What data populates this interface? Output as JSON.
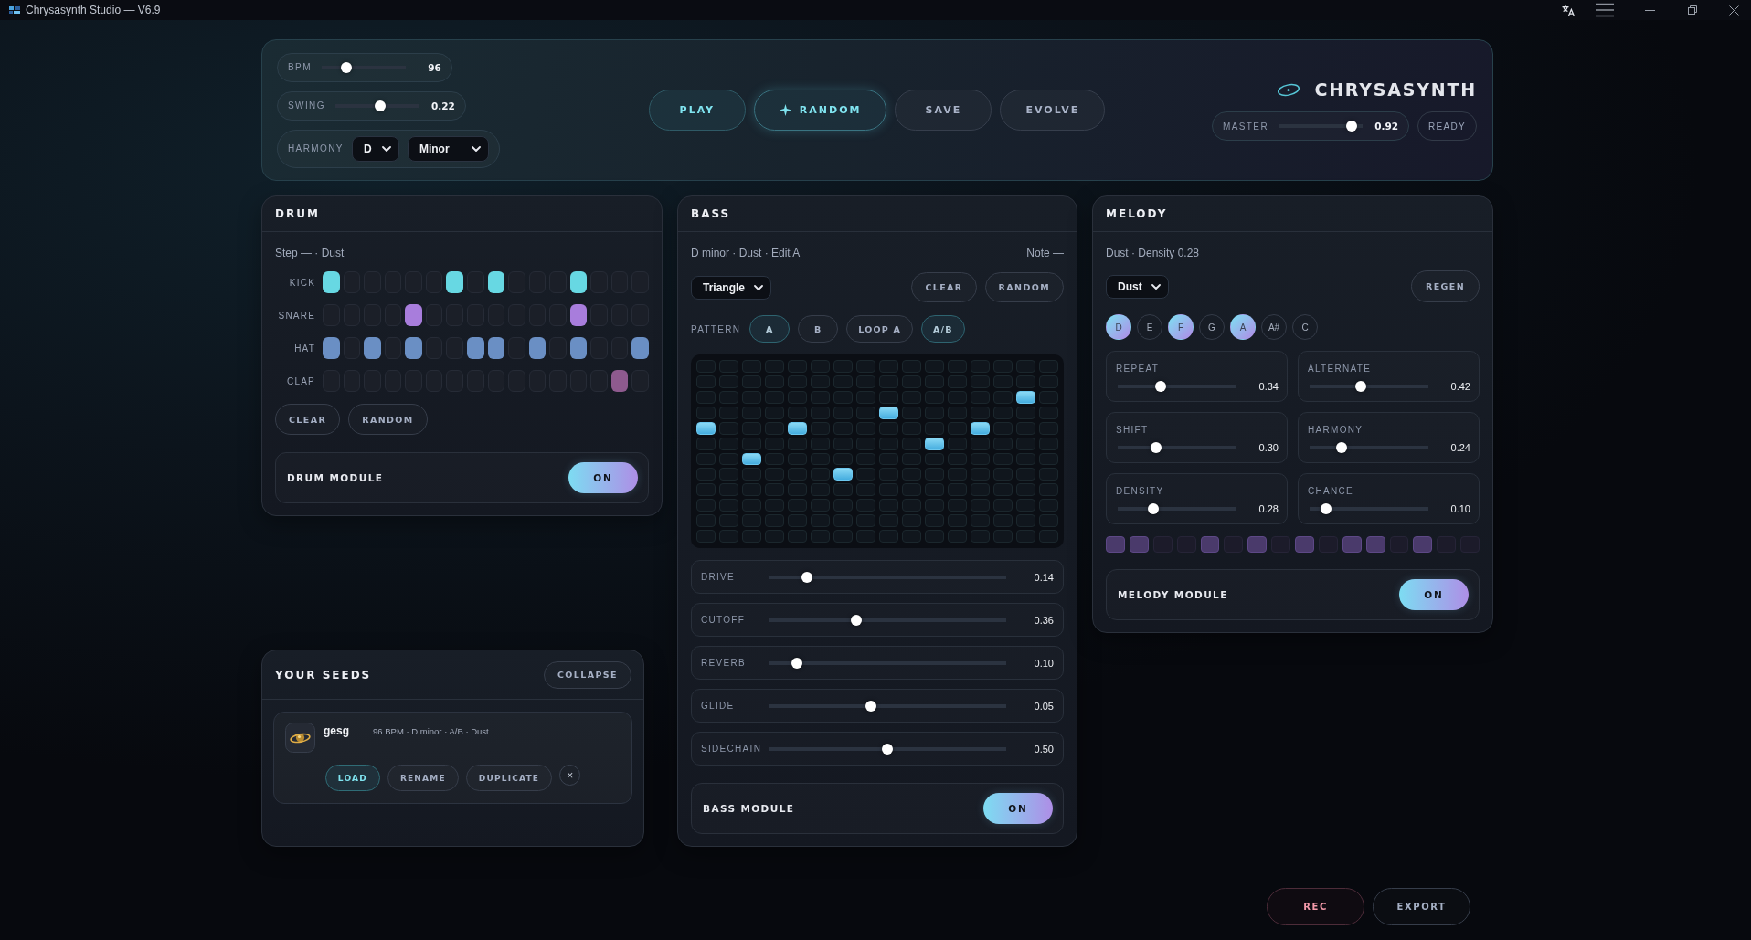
{
  "window": {
    "title": "Chrysasynth Studio — V6.9"
  },
  "header": {
    "params": [
      {
        "kind": "slider",
        "label": "BPM",
        "level": 0.3,
        "reading": "96"
      },
      {
        "kind": "slider",
        "label": "SWING",
        "level": 0.53,
        "reading": "0.22"
      },
      {
        "kind": "selects",
        "label": "HARMONY",
        "selects": [
          {
            "value": "D"
          },
          {
            "value": "Minor"
          }
        ]
      }
    ],
    "actions": [
      {
        "kind": "accent",
        "label": "PLAY"
      },
      {
        "kind": "featured",
        "label": "RANDOM"
      },
      {
        "kind": "plain",
        "label": "SAVE"
      },
      {
        "kind": "plain",
        "label": "EVOLVE"
      }
    ],
    "brand": {
      "name": "CHRYSASYNTH"
    },
    "master": {
      "label": "MASTER",
      "level": 0.87,
      "reading": "0.92"
    },
    "status": "READY"
  },
  "drum": {
    "title": "DRUM",
    "subtitle": "Step — · Dust",
    "rows": [
      {
        "label": "KICK",
        "color": "#67d8e3",
        "steps": [
          true,
          false,
          false,
          false,
          false,
          false,
          true,
          false,
          true,
          false,
          false,
          false,
          true,
          false,
          false,
          false
        ]
      },
      {
        "label": "SNARE",
        "color": "#a87ddc",
        "steps": [
          false,
          false,
          false,
          false,
          true,
          false,
          false,
          false,
          false,
          false,
          false,
          false,
          true,
          false,
          false,
          false
        ]
      },
      {
        "label": "HAT",
        "color": "#6a8fc4",
        "steps": [
          true,
          false,
          true,
          false,
          true,
          false,
          false,
          true,
          true,
          false,
          true,
          false,
          true,
          false,
          false,
          true
        ]
      },
      {
        "label": "CLAP",
        "color": "#8e5a8e",
        "steps": [
          false,
          false,
          false,
          false,
          false,
          false,
          false,
          false,
          false,
          false,
          false,
          false,
          false,
          false,
          true,
          false
        ]
      }
    ],
    "buttons": [
      "CLEAR",
      "RANDOM"
    ],
    "module": {
      "label": "DRUM MODULE",
      "toggle": {
        "label": "ON",
        "on": true
      }
    }
  },
  "bass": {
    "title": "BASS",
    "subtitle": "D minor · Dust · Edit A",
    "note": "Note —",
    "wave": {
      "value": "Triangle"
    },
    "buttons": [
      "CLEAR",
      "RANDOM"
    ],
    "pattern": {
      "label": "PATTERN",
      "options": [
        {
          "label": "A",
          "selected": true
        },
        {
          "label": "B",
          "selected": false
        },
        {
          "label": "LOOP A",
          "selected": false
        },
        {
          "label": "A/B",
          "selected": true
        }
      ]
    },
    "grid": [
      [
        false,
        false,
        false,
        false,
        false,
        false,
        false,
        false,
        false,
        false,
        false,
        false,
        false,
        false,
        false,
        false
      ],
      [
        false,
        false,
        false,
        false,
        false,
        false,
        false,
        false,
        false,
        false,
        false,
        false,
        false,
        false,
        false,
        false
      ],
      [
        false,
        false,
        false,
        false,
        false,
        false,
        false,
        false,
        false,
        false,
        false,
        false,
        false,
        false,
        true,
        false
      ],
      [
        false,
        false,
        false,
        false,
        false,
        false,
        false,
        false,
        true,
        false,
        false,
        false,
        false,
        false,
        false,
        false
      ],
      [
        true,
        false,
        false,
        false,
        true,
        false,
        false,
        false,
        false,
        false,
        false,
        false,
        true,
        false,
        false,
        false
      ],
      [
        false,
        false,
        false,
        false,
        false,
        false,
        false,
        false,
        false,
        false,
        true,
        false,
        false,
        false,
        false,
        false
      ],
      [
        false,
        false,
        true,
        false,
        false,
        false,
        false,
        false,
        false,
        false,
        false,
        false,
        false,
        false,
        false,
        false
      ],
      [
        false,
        false,
        false,
        false,
        false,
        false,
        true,
        false,
        false,
        false,
        false,
        false,
        false,
        false,
        false,
        false
      ],
      [
        false,
        false,
        false,
        false,
        false,
        false,
        false,
        false,
        false,
        false,
        false,
        false,
        false,
        false,
        false,
        false
      ],
      [
        false,
        false,
        false,
        false,
        false,
        false,
        false,
        false,
        false,
        false,
        false,
        false,
        false,
        false,
        false,
        false
      ],
      [
        false,
        false,
        false,
        false,
        false,
        false,
        false,
        false,
        false,
        false,
        false,
        false,
        false,
        false,
        false,
        false
      ],
      [
        false,
        false,
        false,
        false,
        false,
        false,
        false,
        false,
        false,
        false,
        false,
        false,
        false,
        false,
        false,
        false
      ]
    ],
    "params": [
      {
        "label": "DRIVE",
        "level": 0.16,
        "reading": "0.14"
      },
      {
        "label": "CUTOFF",
        "level": 0.37,
        "reading": "0.36"
      },
      {
        "label": "REVERB",
        "level": 0.12,
        "reading": "0.10"
      },
      {
        "label": "GLIDE",
        "level": 0.43,
        "reading": "0.05"
      },
      {
        "label": "SIDECHAIN",
        "level": 0.5,
        "reading": "0.50"
      }
    ],
    "module": {
      "label": "BASS MODULE",
      "toggle": {
        "label": "ON",
        "on": true
      }
    }
  },
  "melody": {
    "title": "MELODY",
    "subtitle": "Dust · Density 0.28",
    "preset": {
      "value": "Dust"
    },
    "regen": "REGEN",
    "notes": [
      {
        "label": "D",
        "selected": true
      },
      {
        "label": "E",
        "selected": false
      },
      {
        "label": "F",
        "selected": true
      },
      {
        "label": "G",
        "selected": false
      },
      {
        "label": "A",
        "selected": true
      },
      {
        "label": "A#",
        "selected": false
      },
      {
        "label": "C",
        "selected": false
      }
    ],
    "params": [
      {
        "label": "REPEAT",
        "level": 0.36,
        "reading": "0.34"
      },
      {
        "label": "ALTERNATE",
        "level": 0.43,
        "reading": "0.42"
      },
      {
        "label": "SHIFT",
        "level": 0.32,
        "reading": "0.30"
      },
      {
        "label": "HARMONY",
        "level": 0.27,
        "reading": "0.24"
      },
      {
        "label": "DENSITY",
        "level": 0.3,
        "reading": "0.28"
      },
      {
        "label": "CHANCE",
        "level": 0.14,
        "reading": "0.10"
      }
    ],
    "steps": [
      true,
      true,
      false,
      false,
      true,
      false,
      true,
      false,
      true,
      false,
      true,
      true,
      false,
      true,
      false,
      false
    ],
    "module": {
      "label": "MELODY MODULE",
      "toggle": {
        "label": "ON",
        "on": true
      }
    }
  },
  "seeds": {
    "title": "YOUR SEEDS",
    "collapse": "COLLAPSE",
    "items": [
      {
        "name": "gesg",
        "meta": "96 BPM · D minor · A/B · Dust",
        "actions": [
          {
            "label": "LOAD",
            "kind": "primary"
          },
          {
            "label": "RENAME",
            "kind": "plain"
          },
          {
            "label": "DUPLICATE",
            "kind": "plain"
          }
        ],
        "remove": "×"
      }
    ]
  },
  "footer": {
    "buttons": [
      {
        "label": "REC",
        "kind": "record"
      },
      {
        "label": "EXPORT",
        "kind": "plain"
      }
    ]
  }
}
